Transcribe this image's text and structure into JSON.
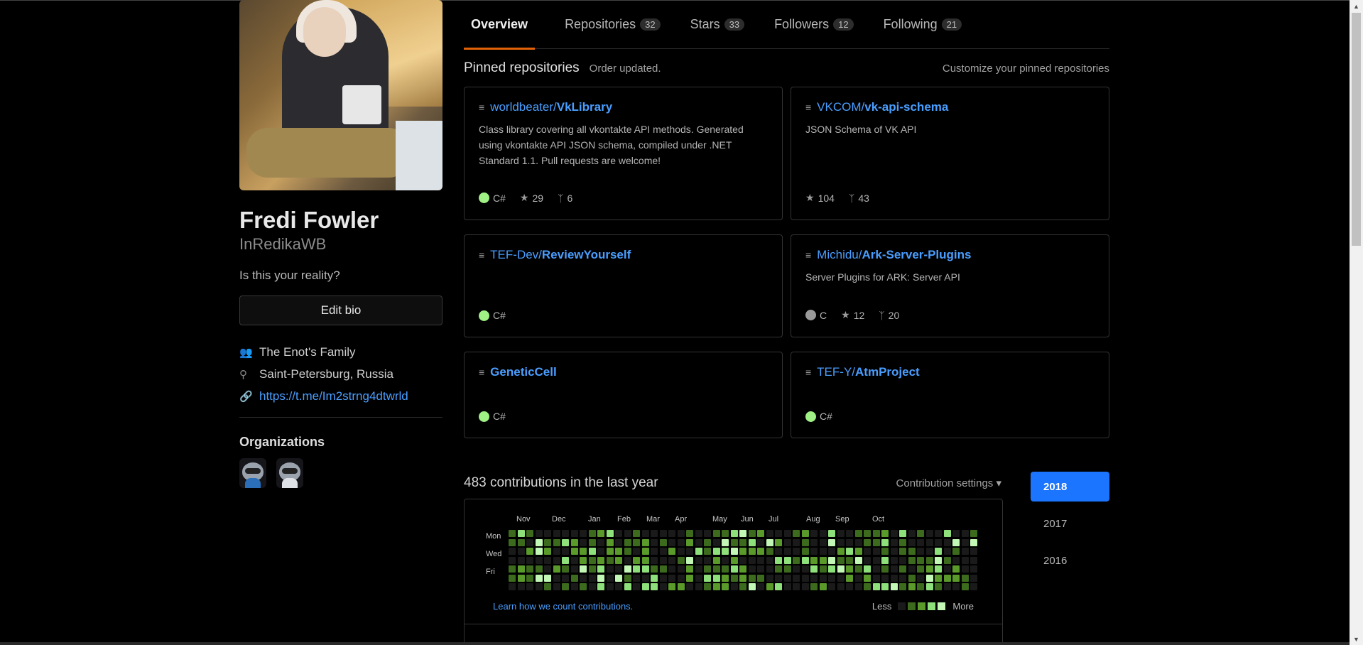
{
  "profile": {
    "name": "Fredi Fowler",
    "username": "InRedikaWB",
    "bio": "Is this your reality?",
    "edit_bio_label": "Edit bio",
    "company": "The Enot's Family",
    "location": "Saint-Petersburg, Russia",
    "website": "https://t.me/Im2strng4dtwrld",
    "organizations_title": "Organizations"
  },
  "tabs": [
    {
      "label": "Overview",
      "count": ""
    },
    {
      "label": "Repositories",
      "count": "32"
    },
    {
      "label": "Stars",
      "count": "33"
    },
    {
      "label": "Followers",
      "count": "12"
    },
    {
      "label": "Following",
      "count": "21"
    }
  ],
  "pinned": {
    "title": "Pinned repositories",
    "note": "Order updated.",
    "customize": "Customize your pinned repositories",
    "repos": [
      {
        "owner": "worldbeater/",
        "name": "VkLibrary",
        "desc": "Class library covering all vkontakte API methods. Generated using vkontakte API JSON schema, compiled under .NET Standard 1.1. Pull requests are welcome!",
        "lang": "C#",
        "lang_color": "#9ff085",
        "stars": "29",
        "forks": "6"
      },
      {
        "owner": "VKCOM/",
        "name": "vk-api-schema",
        "desc": "JSON Schema of VK API",
        "lang": "",
        "lang_color": "",
        "stars": "104",
        "forks": "43"
      },
      {
        "owner": "TEF-Dev/",
        "name": "ReviewYourself",
        "desc": "",
        "lang": "C#",
        "lang_color": "#9ff085",
        "stars": "",
        "forks": ""
      },
      {
        "owner": "Michidu/",
        "name": "Ark-Server-Plugins",
        "desc": "Server Plugins for ARK: Server API",
        "lang": "C",
        "lang_color": "#9a9a9a",
        "stars": "12",
        "forks": "20"
      },
      {
        "owner": "",
        "name": "GeneticCell",
        "desc": "",
        "lang": "C#",
        "lang_color": "#9ff085",
        "stars": "",
        "forks": ""
      },
      {
        "owner": "TEF-Y/",
        "name": "AtmProject",
        "desc": "",
        "lang": "C#",
        "lang_color": "#9ff085",
        "stars": "",
        "forks": ""
      }
    ]
  },
  "contributions": {
    "title": "483 contributions in the last year",
    "settings": "Contribution settings",
    "months": [
      "Nov",
      "Dec",
      "Jan",
      "Feb",
      "Mar",
      "Apr",
      "May",
      "Jun",
      "Jul",
      "Aug",
      "Sep",
      "Oct"
    ],
    "days": [
      "Mon",
      "Wed",
      "Fri"
    ],
    "learn": "Learn how we count contributions.",
    "less": "Less",
    "more": "More",
    "legend_colors": [
      "#1a1a1a",
      "#3d6b1e",
      "#5a9a2a",
      "#8ee07a",
      "#c3f7b5"
    ],
    "years": [
      "2018",
      "2017",
      "2016"
    ]
  },
  "icons": {
    "company": "people-icon",
    "location": "location-pin-icon",
    "link": "link-icon",
    "repo": "repo-icon",
    "star": "star-icon",
    "fork": "fork-icon"
  }
}
